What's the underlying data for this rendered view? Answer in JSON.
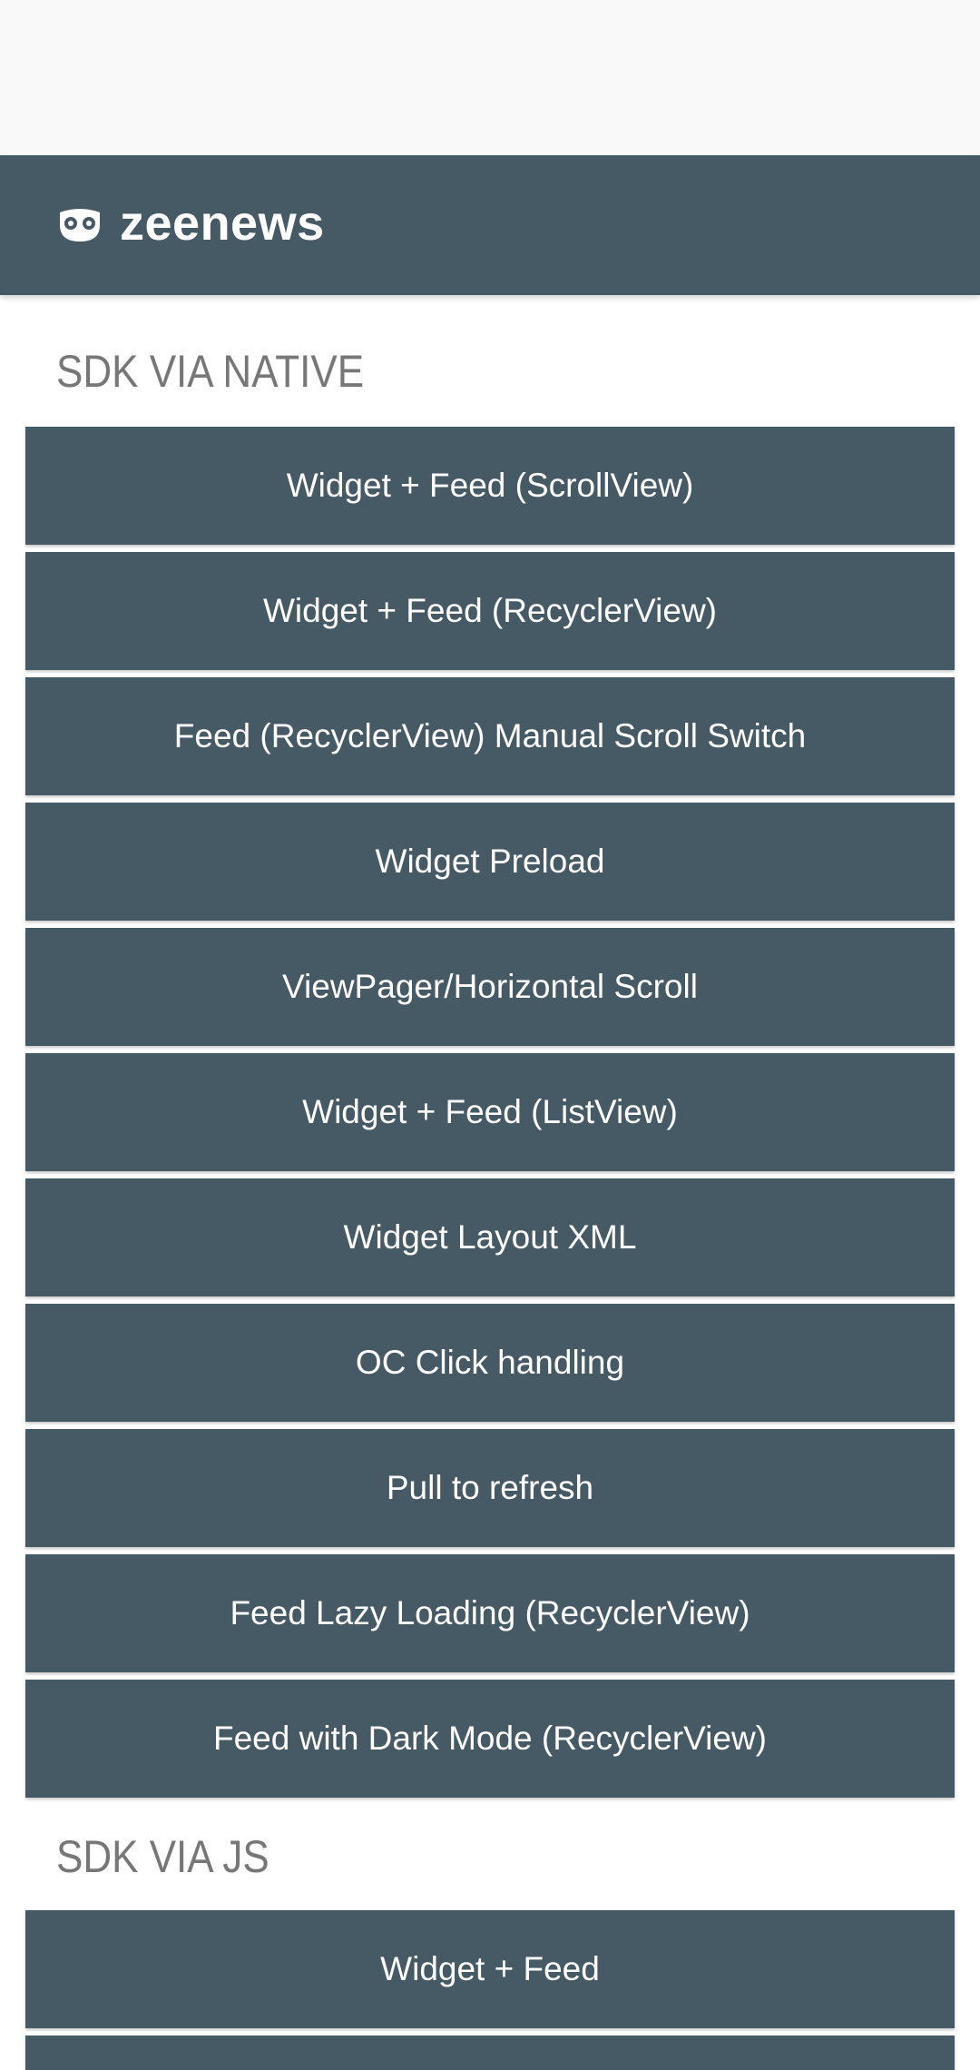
{
  "app": {
    "title": "zeenews",
    "logo_icon": "owl-eyes-logo-icon",
    "bar_color": "#465a66"
  },
  "sections": [
    {
      "header": "SDK VIA NATIVE",
      "buttons": [
        "Widget + Feed (ScrollView)",
        "Widget + Feed (RecyclerView)",
        "Feed (RecyclerView) Manual Scroll Switch",
        "Widget Preload",
        "ViewPager/Horizontal Scroll",
        "Widget + Feed (ListView)",
        "Widget Layout XML",
        "OC Click handling",
        "Pull to refresh",
        "Feed Lazy Loading (RecyclerView)",
        "Feed with Dark Mode (RecyclerView)"
      ]
    },
    {
      "header": "SDK VIA JS",
      "buttons": [
        "Widget + Feed",
        ""
      ]
    }
  ],
  "colors": {
    "button_bg": "#465a66",
    "button_text": "#ffffff",
    "section_header": "#777777",
    "status_bar": "#f9f9f9"
  }
}
